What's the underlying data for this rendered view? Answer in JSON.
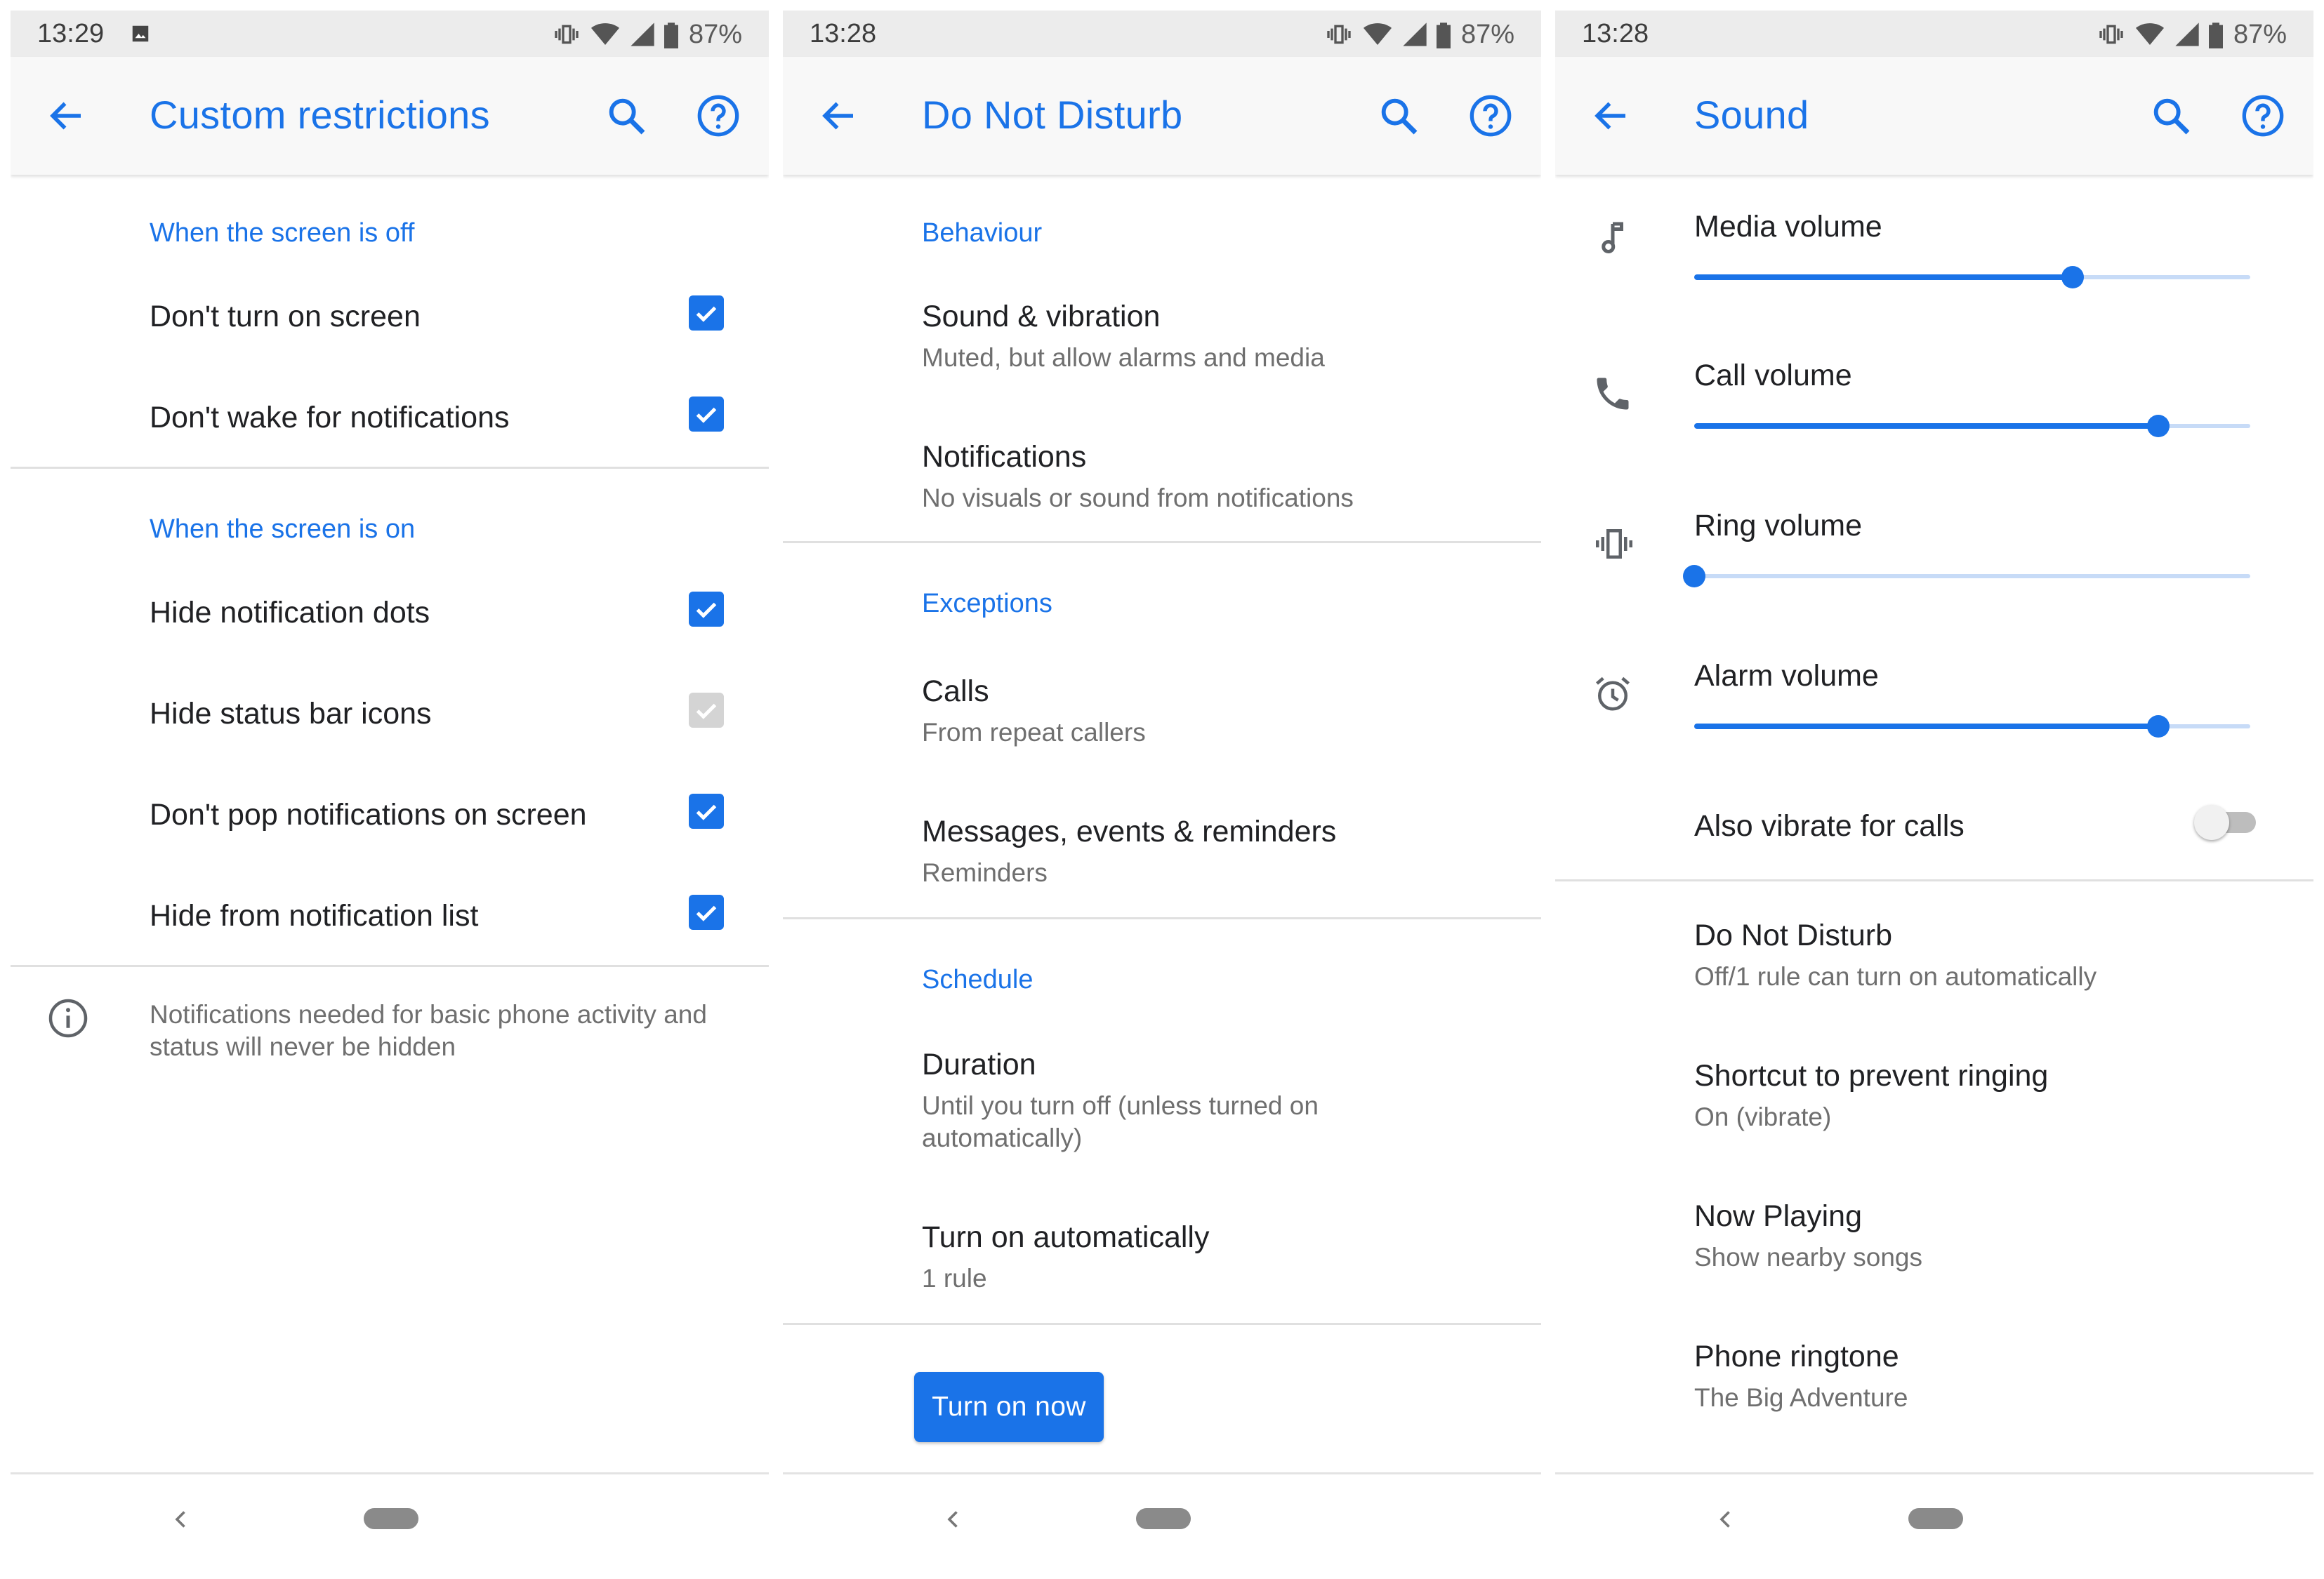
{
  "phones": [
    {
      "status": {
        "time": "13:29",
        "battery": "87%",
        "has_image_icon": true
      },
      "title": "Custom restrictions",
      "sections": [
        {
          "title": "When the screen is off"
        },
        {
          "title": "When the screen is on"
        }
      ],
      "items": [
        {
          "label": "Don't turn on screen",
          "checked": true,
          "enabled": true
        },
        {
          "label": "Don't wake for notifications",
          "checked": true,
          "enabled": true
        },
        {
          "label": "Hide notification dots",
          "checked": true,
          "enabled": true
        },
        {
          "label": "Hide status bar icons",
          "checked": true,
          "enabled": false
        },
        {
          "label": "Don't pop notifications on screen",
          "checked": true,
          "enabled": true
        },
        {
          "label": "Hide from notification list",
          "checked": true,
          "enabled": true
        }
      ],
      "footer_note": "Notifications needed for basic phone activity and status will never be hidden"
    },
    {
      "status": {
        "time": "13:28",
        "battery": "87%"
      },
      "title": "Do Not Disturb",
      "sections": [
        {
          "title": "Behaviour",
          "items": [
            {
              "title": "Sound & vibration",
              "summary": "Muted, but allow alarms and media"
            },
            {
              "title": "Notifications",
              "summary": "No visuals or sound from notifications"
            }
          ]
        },
        {
          "title": "Exceptions",
          "items": [
            {
              "title": "Calls",
              "summary": "From repeat callers"
            },
            {
              "title": "Messages, events & reminders",
              "summary": "Reminders"
            }
          ]
        },
        {
          "title": "Schedule",
          "items": [
            {
              "title": "Duration",
              "summary": "Until you turn off (unless turned on automatically)"
            },
            {
              "title": "Turn on automatically",
              "summary": "1 rule"
            }
          ]
        }
      ],
      "button_label": "Turn on now"
    },
    {
      "status": {
        "time": "13:28",
        "battery": "87%"
      },
      "title": "Sound",
      "volumes": [
        {
          "label": "Media volume",
          "icon": "music-note-icon",
          "level": 0.68
        },
        {
          "label": "Call volume",
          "icon": "phone-icon",
          "level": 0.835
        },
        {
          "label": "Ring volume",
          "icon": "vibrate-icon",
          "level": 0.0
        },
        {
          "label": "Alarm volume",
          "icon": "alarm-clock-icon",
          "level": 0.835
        }
      ],
      "vibrate_toggle": {
        "label": "Also vibrate for calls",
        "on": false
      },
      "items": [
        {
          "title": "Do Not Disturb",
          "summary": "Off/1 rule can turn on automatically"
        },
        {
          "title": "Shortcut to prevent ringing",
          "summary": "On (vibrate)"
        },
        {
          "title": "Now Playing",
          "summary": "Show nearby songs"
        },
        {
          "title": "Phone ringtone",
          "summary": "The Big Adventure"
        }
      ]
    }
  ],
  "colors": {
    "accent": "#1a73e8",
    "status_bar": "#ececec",
    "app_bar": "#f8f8f8",
    "primary_text": "#202124",
    "secondary_text": "#6f6f6f",
    "disabled": "#d4d4d4"
  }
}
